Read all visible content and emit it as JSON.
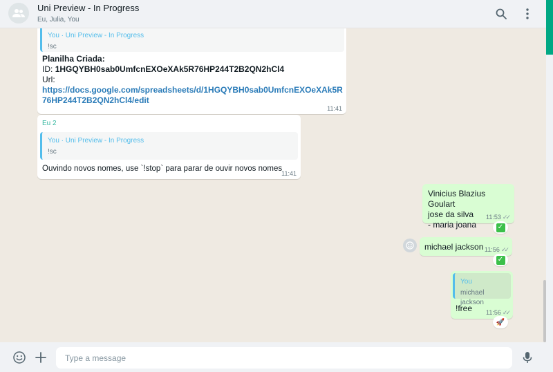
{
  "header": {
    "title": "Uni Preview - In Progress",
    "subtitle": "Eu, Julia, You",
    "avatar_icon": "group-icon",
    "search_icon": "search-icon",
    "menu_icon": "kebab-menu-icon"
  },
  "messages": [
    {
      "quote_author": "You · Uni Preview - In Progress",
      "quote_text": "!sc",
      "heading": "Planilha Criada:",
      "id_label": "ID:",
      "id_value": "1HGQYBH0sab0UmfcnEXOeXAk5R76HP244T2B2QN2hCl4",
      "url_label": "Url:",
      "url_value": "https://docs.google.com/spreadsheets/d/1HGQYBH0sab0UmfcnEXOeXAk5R76HP244T2B2QN2hCl4/edit",
      "time": "11:41"
    },
    {
      "sender": "Eu 2",
      "quote_author": "You · Uni Preview - In Progress",
      "quote_text": "!sc",
      "text": "Ouvindo novos nomes, use `!stop` para parar de ouvir novos nomes",
      "time": "11:41"
    },
    {
      "lines": [
        "Vinicius Blazius Goulart",
        "jose da silva",
        "- maria joana"
      ],
      "time": "11:53",
      "reaction": "✅"
    },
    {
      "text": "michael jackson",
      "time": "11:56",
      "reaction": "✅"
    },
    {
      "quote_author": "You",
      "quote_text": "michael jackson",
      "text": "!free",
      "time": "11:56",
      "reaction": "🚀"
    }
  ],
  "composer": {
    "placeholder": "Type a message",
    "emoji_icon": "emoji-icon",
    "attach_icon": "plus-icon",
    "mic_icon": "microphone-icon"
  },
  "colors": {
    "accent": "#00a884",
    "outgoing": "#d9fdd3",
    "incoming": "#ffffff",
    "quote_bar": "#53bdeb",
    "link": "#2a7bb8"
  }
}
